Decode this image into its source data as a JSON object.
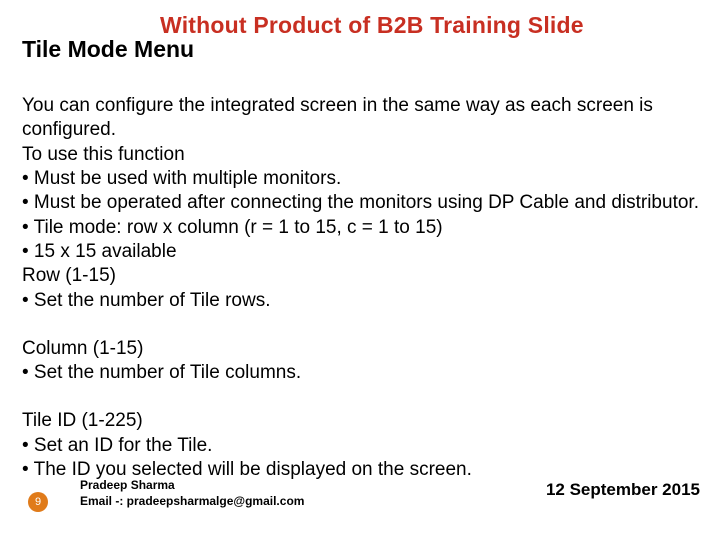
{
  "watermark": "Without Product of B2B Training Slide",
  "title": "Tile Mode Menu",
  "blocks": [
    "You can configure the integrated screen in the same way as each screen is configured.\nTo use this function\n• Must be used with multiple monitors.\n• Must be operated after connecting the monitors using DP Cable and distributor.\n• Tile mode: row x column (r = 1 to 15, c = 1 to 15)\n• 15 x 15 available\nRow (1-15)\n• Set the number of Tile rows.",
    "Column (1-15)\n• Set the number of Tile columns.",
    "Tile ID (1-225)\n• Set an ID for the Tile.\n• The ID you selected will be displayed on the screen."
  ],
  "footer": {
    "page": "9",
    "author": "Pradeep Sharma",
    "email": "Email -: pradeepsharmalge@gmail.com",
    "date": "12 September 2015"
  }
}
